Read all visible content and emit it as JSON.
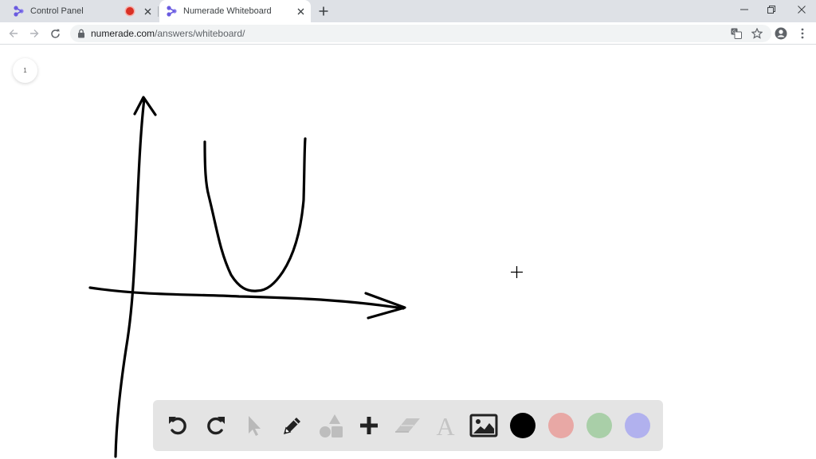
{
  "browser": {
    "tabs": [
      {
        "title": "Control Panel",
        "recording": true
      },
      {
        "title": "Numerade Whiteboard",
        "active": true
      }
    ],
    "url": {
      "host": "numerade.com",
      "path": "/answers/whiteboard/"
    }
  },
  "whiteboard": {
    "page_number": "1",
    "colors": {
      "black": "#000000",
      "red": "#e8a8a5",
      "green": "#a9cfa8",
      "blue": "#b1b1ee"
    },
    "tools": [
      "undo-icon",
      "redo-icon",
      "select-pointer-icon",
      "pencil-icon",
      "shapes-icon",
      "plus-icon",
      "eraser-icon",
      "text-tool-icon",
      "image-icon"
    ],
    "text_tool_glyph": "A",
    "active_tool": "pencil"
  }
}
